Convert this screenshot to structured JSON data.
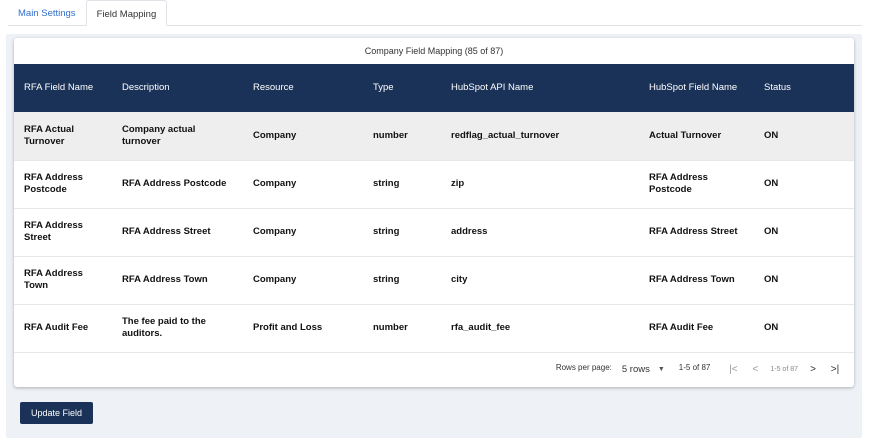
{
  "tabs": [
    {
      "label": "Main Settings"
    },
    {
      "label": "Field Mapping"
    }
  ],
  "card": {
    "title": "Company Field Mapping (85 of 87)"
  },
  "table": {
    "headers": [
      "RFA Field Name",
      "Description",
      "Resource",
      "Type",
      "HubSpot API Name",
      "HubSpot Field Name",
      "Status"
    ],
    "rows": [
      [
        "RFA Actual Turnover",
        "Company actual turnover",
        "Company",
        "number",
        "redflag_actual_turnover",
        "Actual Turnover",
        "ON"
      ],
      [
        "RFA Address Postcode",
        "RFA Address Postcode",
        "Company",
        "string",
        "zip",
        "RFA Address Postcode",
        "ON"
      ],
      [
        "RFA Address Street",
        "RFA Address Street",
        "Company",
        "string",
        "address",
        "RFA Address Street",
        "ON"
      ],
      [
        "RFA Address Town",
        "RFA Address Town",
        "Company",
        "string",
        "city",
        "RFA Address Town",
        "ON"
      ],
      [
        "RFA Audit Fee",
        "The fee paid to the auditors.",
        "Profit and Loss",
        "number",
        "rfa_audit_fee",
        "RFA Audit Fee",
        "ON"
      ]
    ]
  },
  "pagination": {
    "rows_per_page_label": "Rows per page:",
    "rows_per_page_value": "5 rows",
    "range_text": "1-5 of 87",
    "mini_range_text": "1-5 of 87",
    "first": "|<",
    "prev": "<",
    "next": ">",
    "last": ">|"
  },
  "update_button": {
    "label": "Update Field"
  }
}
